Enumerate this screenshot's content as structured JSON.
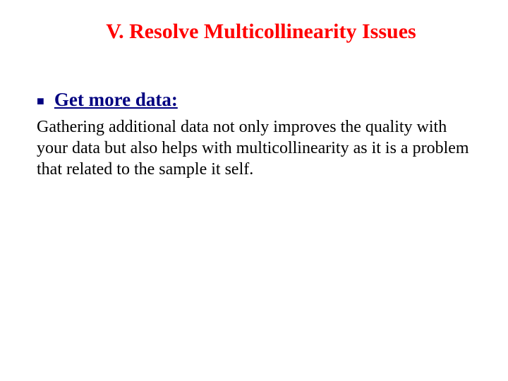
{
  "slide": {
    "title": "V. Resolve Multicollinearity Issues",
    "bullet": {
      "heading": "Get more data:",
      "body": "Gathering additional data not only improves the quality with your data but also helps with multicollinearity as it is a problem that related to the sample it self."
    }
  }
}
